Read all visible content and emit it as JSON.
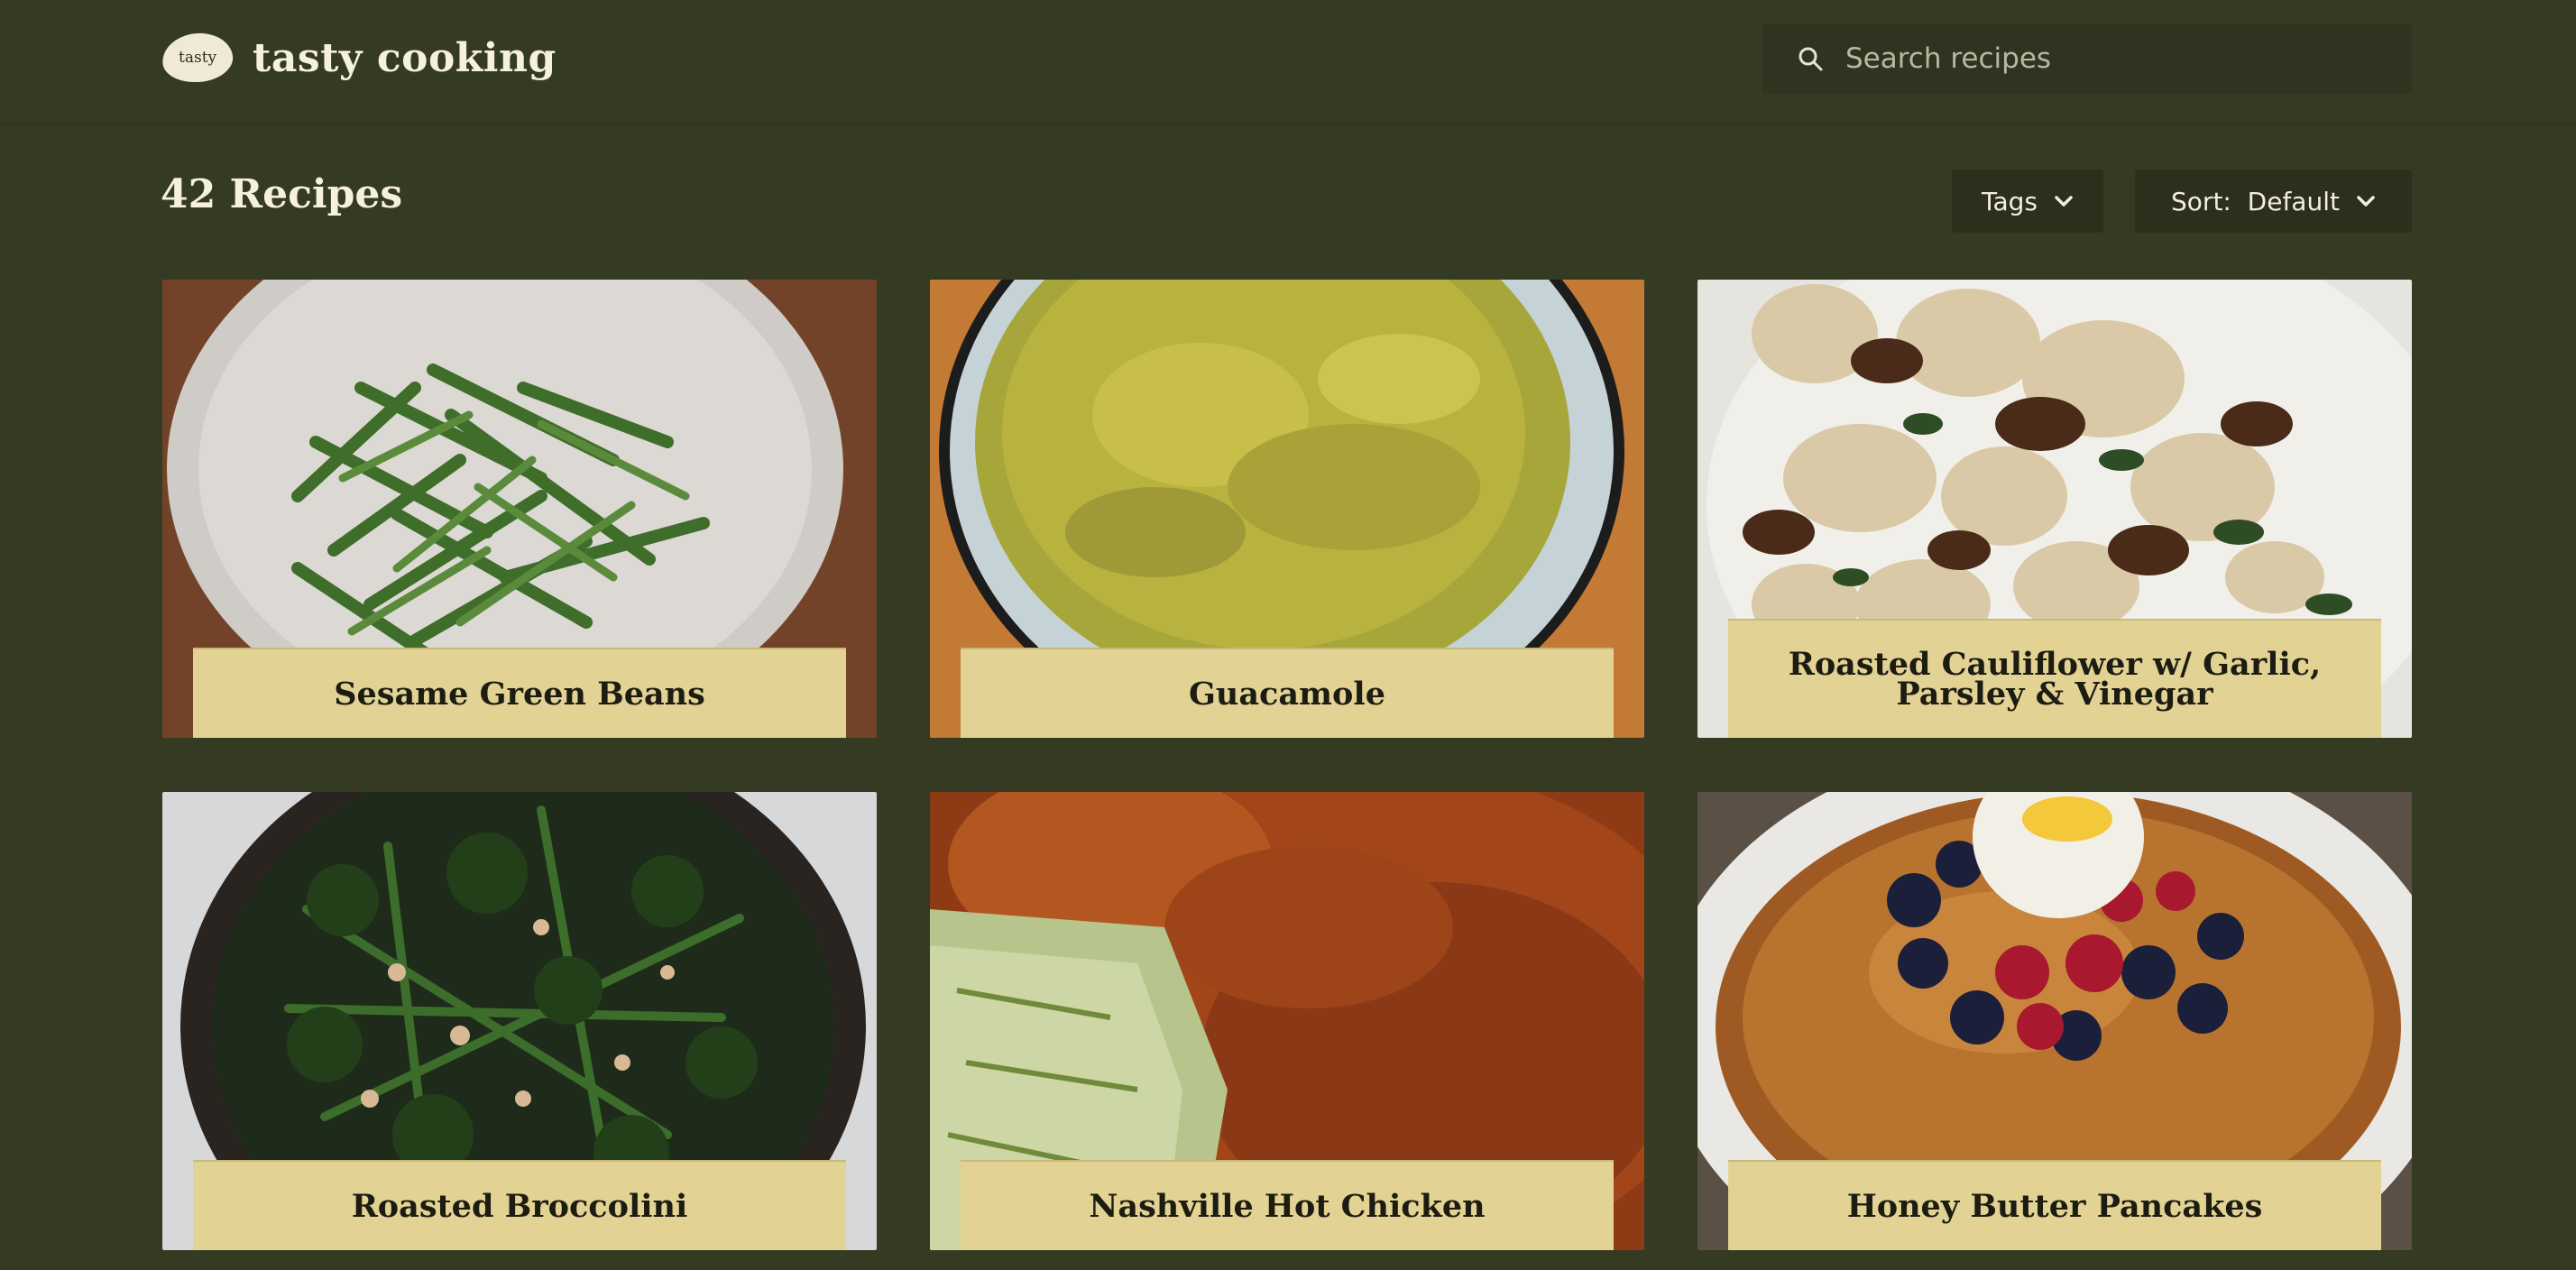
{
  "header": {
    "logo_mark": "tasty",
    "logo_text": "tasty cooking",
    "search_placeholder": "Search recipes"
  },
  "toolbar": {
    "count": "42 Recipes",
    "tags_label": "Tags",
    "sort_label": "Sort:  Default"
  },
  "icons": {
    "search": "search-icon",
    "chevron": "chevron-down-icon"
  },
  "colors": {
    "background": "#353a22",
    "title_box": "#e2d394",
    "control_bg": "#2b2f1c"
  },
  "recipes": [
    {
      "title": "Sesame Green Beans"
    },
    {
      "title": "Guacamole"
    },
    {
      "title": "Roasted Cauliflower w/ Garlic, Parsley & Vinegar"
    },
    {
      "title": "Roasted Broccolini"
    },
    {
      "title": "Nashville Hot Chicken"
    },
    {
      "title": "Honey Butter Pancakes"
    }
  ]
}
